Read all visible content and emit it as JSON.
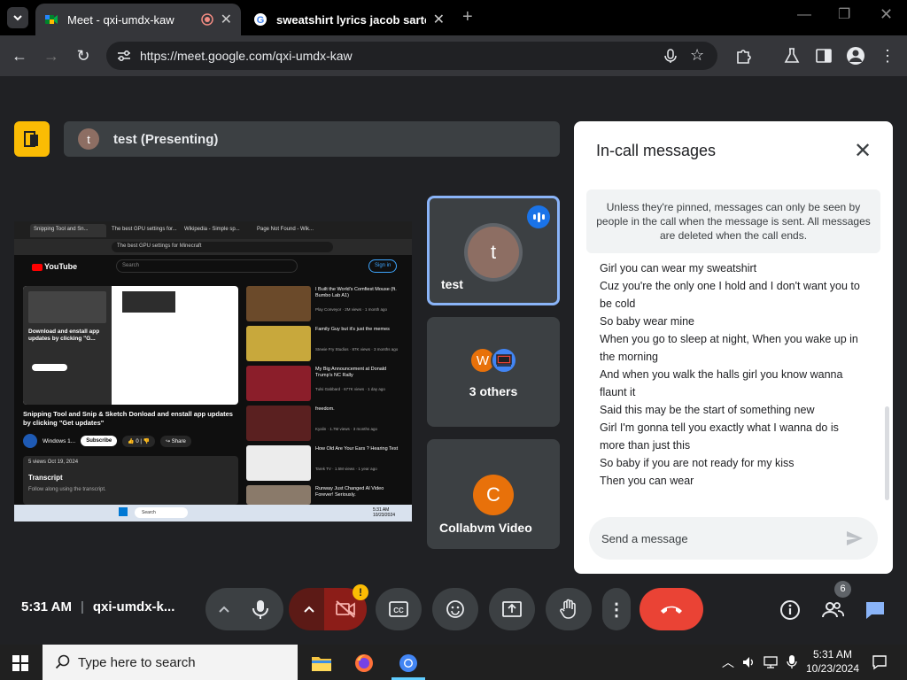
{
  "browser": {
    "tabs": [
      {
        "title": "Meet - qxi-umdx-kaw",
        "active": true
      },
      {
        "title": "sweatshirt lyrics jacob sartorius",
        "active": false
      }
    ],
    "new_tab": "+",
    "url": "https://meet.google.com/qxi-umdx-kaw"
  },
  "meet": {
    "presenting_initial": "t",
    "presenting_label": "test (Presenting)",
    "shared_screen": {
      "tabs": [
        "Snipping Tool and Sn...",
        "The best GPU settings for...",
        "Wikipedia - Simple sp...",
        "Page Not Found - Wik..."
      ],
      "url": "The best GPU settings for Minecraft",
      "logo": "YouTube",
      "search_placeholder": "Search",
      "sign_in": "Sign in",
      "video_inner_text": "Download and enstall app updates by clicking \"G...",
      "video_title": "Snipping Tool and Snip & Sketch Donload and enstall app updates by clicking \"Get updates\"",
      "channel": "Windows 1...",
      "subscribe": "Subscribe",
      "likes": "0",
      "share": "Share",
      "desc_meta": "5 views  Oct 19, 2024",
      "transcript": "Transcript",
      "transcript_sub": "Follow along using the transcript.",
      "recommendations": [
        {
          "title": "I Built the World's Comfiest Mouse (ft. Bumbo Lab A1)",
          "meta": "Play Conveyor · 2M views · 1 month ago"
        },
        {
          "title": "Family Guy but it's just the memes",
          "meta": "Stewie Fry Studios · 87K views · 3 months ago"
        },
        {
          "title": "My Big Announcement at Donald Trump's NC Rally",
          "meta": "Tulsi Gabbard · 677K views · 1 day ago"
        },
        {
          "title": "freedom.",
          "meta": "Kyalin · 1.7M views · 3 months ago"
        },
        {
          "title": "How Old Are Your Ears ? Hearing Test",
          "meta": "Tarek TV · 1.5M views · 1 year ago"
        },
        {
          "title": "Runway Just Changed AI Video Forever! Seriously.",
          "meta": "Theoretically Media"
        }
      ],
      "taskbar_search": "Search",
      "taskbar_time": "5:31 AM",
      "taskbar_date": "10/23/2024"
    },
    "participants": [
      {
        "name": "test",
        "initial": "t"
      },
      {
        "name": "3 others",
        "initial": "W"
      },
      {
        "name": "Collabvm Video",
        "initial": "C"
      }
    ],
    "chat": {
      "title": "In-call messages",
      "notice": "Unless they're pinned, messages can only be seen by people in the call when the message is sent. All messages are deleted when the call ends.",
      "messages": [
        "Girl you can wear my sweatshirt",
        "Cuz you're the only one I hold and I don't want you to be cold",
        "So baby wear mine",
        "When you go to sleep at night, When you wake up in the morning",
        "And when you walk the halls girl you know wanna flaunt it",
        "Said this may be the start of something new",
        "Girl I'm gonna tell you exactly what I wanna do is more than just this",
        "So baby if you are not ready for my kiss",
        "Then you can wear"
      ],
      "input_placeholder": "Send a message"
    },
    "controls": {
      "time": "5:31 AM",
      "meeting_code": "qxi-umdx-k...",
      "people_count": "6",
      "camera_warning": "!"
    }
  },
  "taskbar": {
    "search_placeholder": "Type here to search",
    "time": "5:31 AM",
    "date": "10/23/2024"
  },
  "colors": {
    "accent_blue": "#8ab4f8",
    "hangup_red": "#ea4335",
    "presenter_yellow": "#fbbc04",
    "camera_off_red": "#8c1d18"
  }
}
